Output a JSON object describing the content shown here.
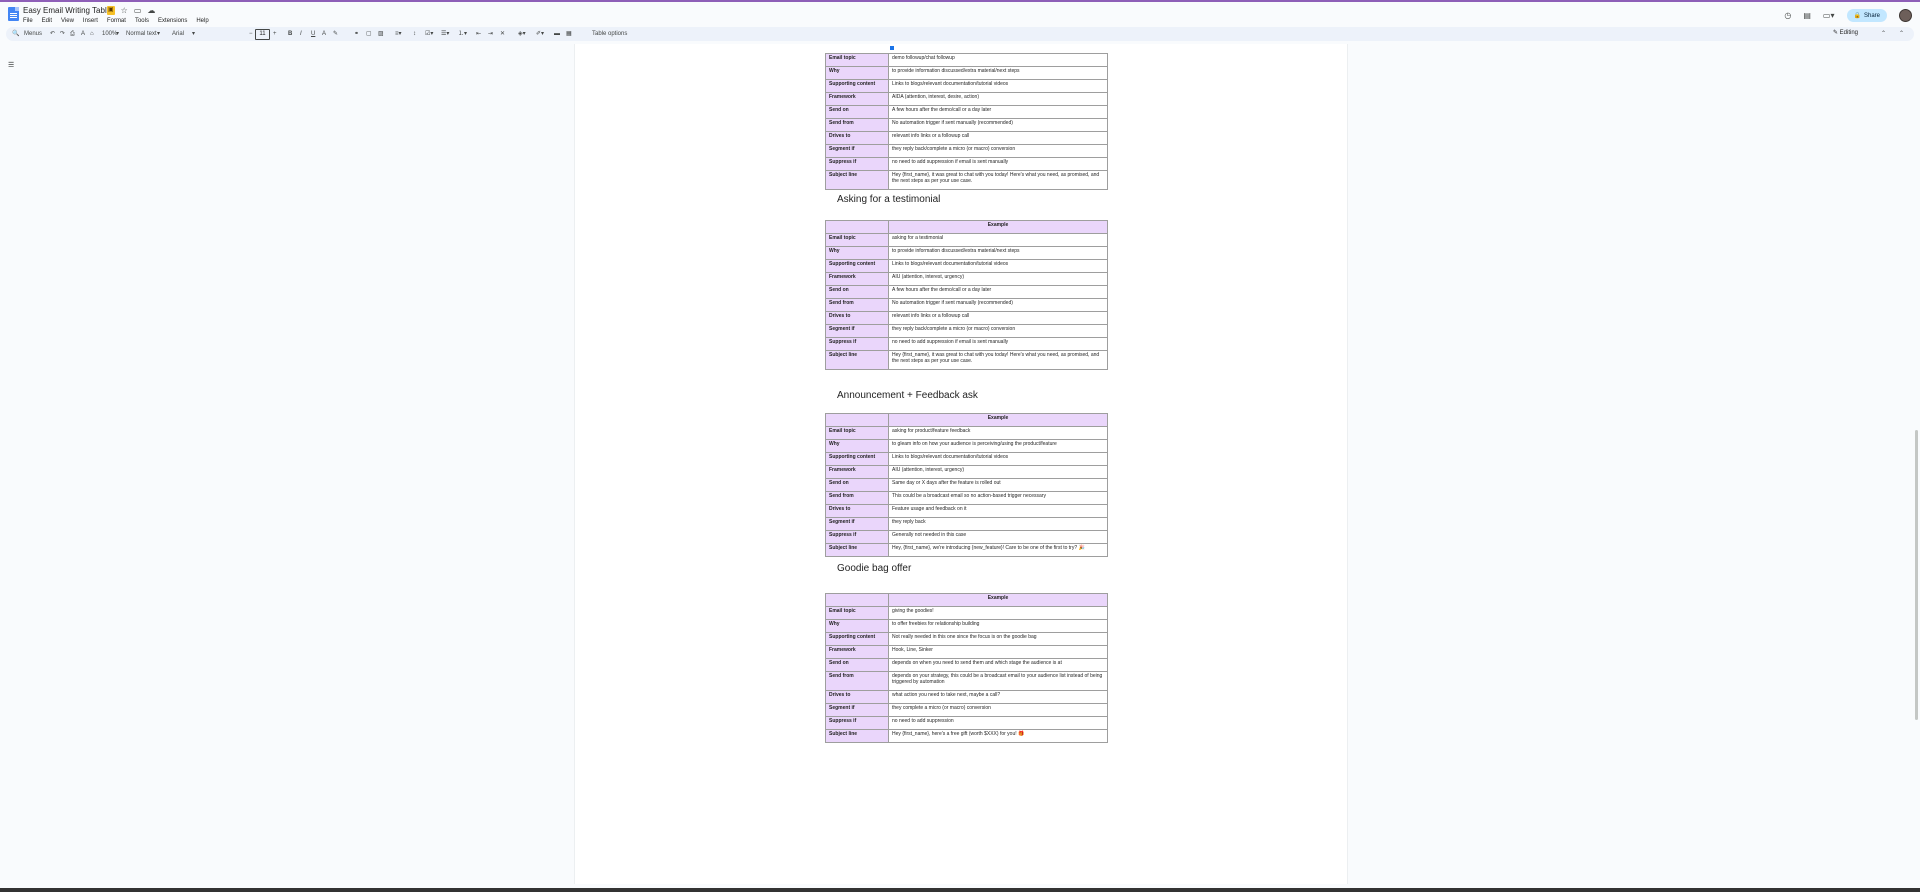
{
  "app": {
    "doc_title": "Easy Email Writing Tables",
    "menu": [
      "File",
      "Edit",
      "View",
      "Insert",
      "Format",
      "Tools",
      "Extensions",
      "Help"
    ],
    "share_label": "Share",
    "editing_label": "Editing",
    "table_options_label": "Table options",
    "search_menus": "Menus",
    "zoom": "100%",
    "style": "Normal text",
    "font": "Arial",
    "font_size": "11"
  },
  "labels": [
    "Email topic",
    "Why",
    "Supporting content",
    "Framework",
    "Send on",
    "Send from",
    "Drives to",
    "Segment if",
    "Suppress if",
    "Subject line"
  ],
  "example_header": "Example",
  "sections": [
    {
      "heading": "",
      "values": [
        "demo followup/chat followup",
        "to provide information discussed/extra material/next steps",
        "Links to blogs/relevant documentation/tutorial videos",
        "AIDA (attention, interest, desire, action)",
        "A few hours after the demo/call or a day later",
        "No automation trigger if sent manually (recommended)",
        "relevant info links or a followup call",
        "they reply back/complete a micro (or macro) conversion",
        "no need to add suppression if email is sent manually",
        "Hey {first_name}, it was great to chat with you today! Here's what you need, as promised, and the next steps as per your use case."
      ]
    },
    {
      "heading": "Asking for a testimonial",
      "values": [
        "asking for a testimonial",
        "to provide information discussed/extra material/next steps",
        "Links to blogs/relevant documentation/tutorial videos",
        "AIU (attention, interest, urgency)",
        "A few hours after the demo/call or a day later",
        "No automation trigger if sent manually (recommended)",
        "relevant info links or a followup call",
        "they reply back/complete a micro (or macro) conversion",
        "no need to add suppression if email is sent manually",
        "Hey {first_name}, it was great to chat with you today! Here's what you need, as promised, and the next steps as per your use case."
      ]
    },
    {
      "heading": "Announcement + Feedback ask",
      "values": [
        "asking for product/feature feedback",
        "to gleam info on how your audience is perceiving/using the product/feature",
        "Links to blogs/relevant documentation/tutorial videos",
        "AIU (attention, interest, urgency)",
        "Same day or X days after the feature is rolled out",
        "This could be a broadcast email so no action-based trigger necessary",
        "Feature usage and feedback on it",
        "they reply back",
        "Generally not needed in this case",
        "Hey, {first_name}, we're introducing {new_feature}! Care to be one of the first to try? 🎉"
      ]
    },
    {
      "heading": "Goodie bag offer",
      "values": [
        "giving the goodies!",
        "to offer freebies for relationship building",
        "Not really needed in this one since the focus is on the goodie bag",
        "Hook, Line, Sinker",
        "depends on when you need to send them and which stage the audience is at",
        "depends on your strategy, this could be a broadcast email to your audience list instead of being triggered by automation",
        "what action you need to take next, maybe a call?",
        "they complete a micro (or macro) conversion",
        "no need to add suppression",
        "Hey {first_name}, here's a free gift (worth $XXX) for you! 🎁"
      ]
    }
  ]
}
